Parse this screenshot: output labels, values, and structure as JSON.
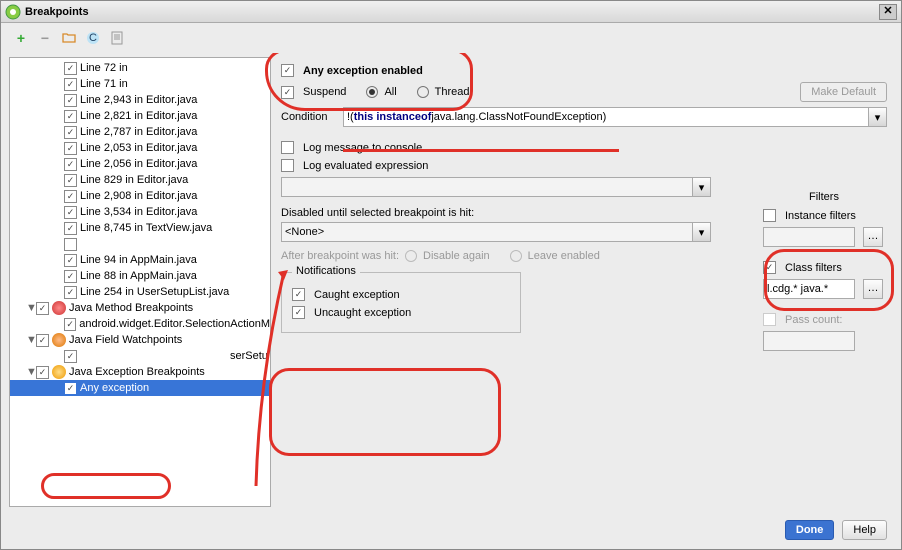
{
  "window": {
    "title": "Breakpoints"
  },
  "toolbar": {
    "add": "+",
    "remove": "−"
  },
  "tree": {
    "items": [
      {
        "label": "Line 72 in",
        "sel": false,
        "indent": 2,
        "chk": true
      },
      {
        "label": "Line 71 in",
        "sel": false,
        "indent": 2,
        "chk": true
      },
      {
        "label": "Line 2,943 in Editor.java",
        "sel": false,
        "indent": 2,
        "chk": true
      },
      {
        "label": "Line 2,821 in Editor.java",
        "sel": false,
        "indent": 2,
        "chk": true
      },
      {
        "label": "Line 2,787 in Editor.java",
        "sel": false,
        "indent": 2,
        "chk": true
      },
      {
        "label": "Line 2,053 in Editor.java",
        "sel": false,
        "indent": 2,
        "chk": true
      },
      {
        "label": "Line 2,056 in Editor.java",
        "sel": false,
        "indent": 2,
        "chk": true
      },
      {
        "label": "Line 829 in Editor.java",
        "sel": false,
        "indent": 2,
        "chk": true
      },
      {
        "label": "Line 2,908 in Editor.java",
        "sel": false,
        "indent": 2,
        "chk": true
      },
      {
        "label": "Line 3,534 in Editor.java",
        "sel": false,
        "indent": 2,
        "chk": true
      },
      {
        "label": "Line 8,745 in TextView.java",
        "sel": false,
        "indent": 2,
        "chk": true
      },
      {
        "label": "",
        "sel": false,
        "indent": 2,
        "chk": false
      },
      {
        "label": "Line 94 in AppMain.java",
        "sel": false,
        "indent": 2,
        "chk": true
      },
      {
        "label": "Line 88 in AppMain.java",
        "sel": false,
        "indent": 2,
        "chk": true
      },
      {
        "label": "Line 254 in UserSetupList.java",
        "sel": false,
        "indent": 2,
        "chk": true
      }
    ],
    "group_method": "Java Method Breakpoints",
    "group_method_item": "android.widget.Editor.SelectionActionM",
    "group_field": "Java Field Watchpoints",
    "group_field_item_suffix": "serSetu",
    "group_exc": "Java Exception Breakpoints",
    "group_exc_item": "Any exception"
  },
  "detail": {
    "enabled_label": "Any exception enabled",
    "suspend": "Suspend",
    "opt_all": "All",
    "opt_thread": "Thread",
    "make_default": "Make Default",
    "condition_label": "Condition",
    "condition_prefix": "!(",
    "condition_kw": "this instanceof",
    "condition_rest": " java.lang.ClassNotFoundException)",
    "log_console": "Log message to console",
    "log_eval": "Log evaluated expression",
    "disabled_until": "Disabled until selected breakpoint is hit:",
    "none": "<None>",
    "after_hit": "After breakpoint was hit:",
    "disable_again": "Disable again",
    "leave_enabled": "Leave enabled",
    "notifications": "Notifications",
    "caught": "Caught exception",
    "uncaught": "Uncaught exception"
  },
  "filters": {
    "header": "Filters",
    "instance": "Instance filters",
    "class": "Class filters",
    "class_value": "l.cdg.* java.*",
    "pass_count": "Pass count:"
  },
  "footer": {
    "done": "Done",
    "help": "Help"
  }
}
